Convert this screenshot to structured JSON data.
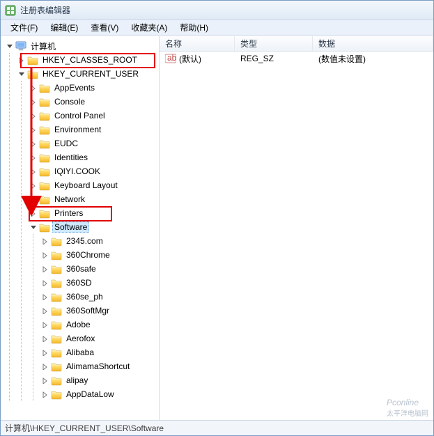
{
  "title": "注册表编辑器",
  "menu": {
    "file": "文件(F)",
    "edit": "编辑(E)",
    "view": "查看(V)",
    "fav": "收藏夹(A)",
    "help": "帮助(H)"
  },
  "tree": {
    "root": "计算机",
    "hives": {
      "hkcr": "HKEY_CLASSES_ROOT",
      "hkcu": "HKEY_CURRENT_USER"
    },
    "hkcu_children": [
      "AppEvents",
      "Console",
      "Control Panel",
      "Environment",
      "EUDC",
      "Identities",
      "IQIYI.COOK",
      "Keyboard Layout",
      "Network",
      "Printers",
      "Software"
    ],
    "software_children": [
      "2345.com",
      "360Chrome",
      "360safe",
      "360SD",
      "360se_ph",
      "360SoftMgr",
      "Adobe",
      "Aerofox",
      "Alibaba",
      "AlimamaShortcut",
      "alipay",
      "AppDataLow"
    ]
  },
  "selected_key": "Software",
  "list": {
    "cols": {
      "name": "名称",
      "type": "类型",
      "data": "数据"
    },
    "rows": [
      {
        "name": "(默认)",
        "type": "REG_SZ",
        "data": "(数值未设置)"
      }
    ]
  },
  "status": "计算机\\HKEY_CURRENT_USER\\Software",
  "watermark": {
    "brand": "Pconline",
    "sub": "太平洋电脑网"
  }
}
